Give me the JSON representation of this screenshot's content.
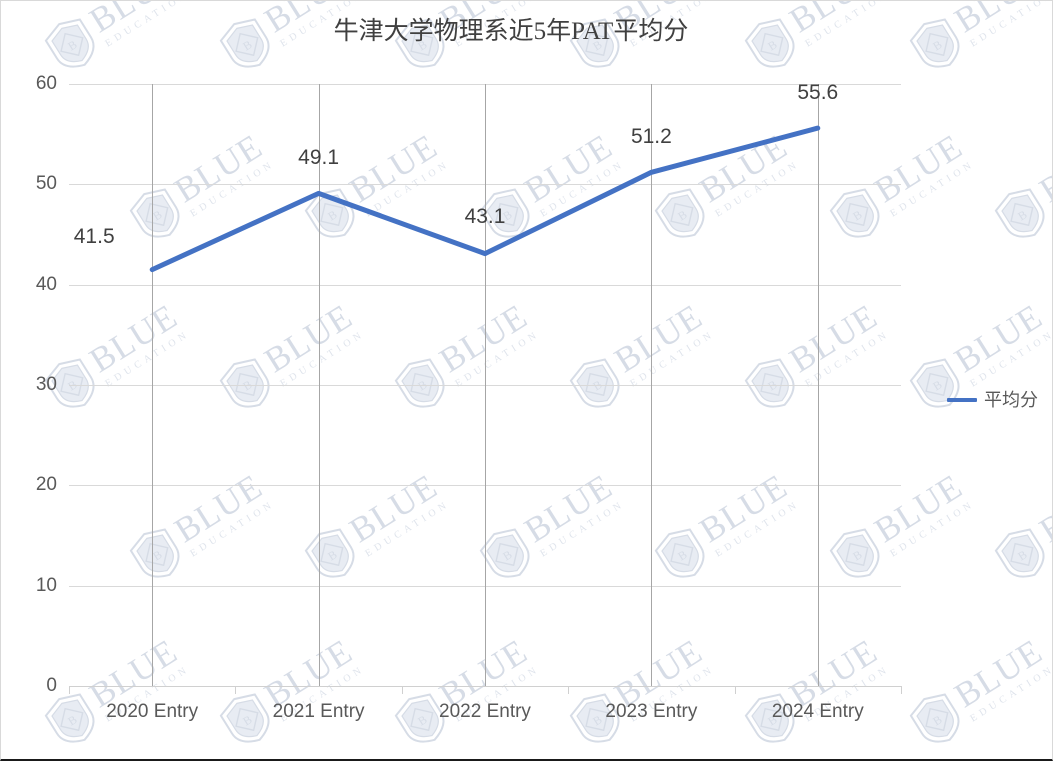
{
  "chart_data": {
    "type": "line",
    "title": "牛津大学物理系近5年PAT平均分",
    "xlabel": "",
    "ylabel": "",
    "categories": [
      "2020 Entry",
      "2021 Entry",
      "2022 Entry",
      "2023 Entry",
      "2024 Entry"
    ],
    "series": [
      {
        "name": "平均分",
        "values": [
          41.5,
          49.1,
          43.1,
          51.2,
          55.6
        ],
        "color": "#4472C4"
      }
    ],
    "data_labels": [
      "41.5",
      "49.1",
      "43.1",
      "51.2",
      "55.6"
    ],
    "ylim": [
      0,
      60
    ],
    "yticks": [
      0,
      10,
      20,
      30,
      40,
      50,
      60
    ],
    "ytick_labels": [
      "0",
      "10",
      "20",
      "30",
      "40",
      "50",
      "60"
    ],
    "grid": "horizontal-major-plus-category-verticals",
    "legend_position": "right",
    "legend_entries": [
      "平均分"
    ]
  },
  "watermark": {
    "primary_text": "BLUE",
    "secondary_text": "EDUCATION",
    "badge_letter": "B",
    "color": "#d6dce6"
  },
  "colors": {
    "series_line": "#4472C4",
    "gridline": "#d9d9d9",
    "category_line": "#a6a6a6",
    "tick_text": "#595959",
    "title_text": "#404040",
    "label_text": "#404040"
  }
}
